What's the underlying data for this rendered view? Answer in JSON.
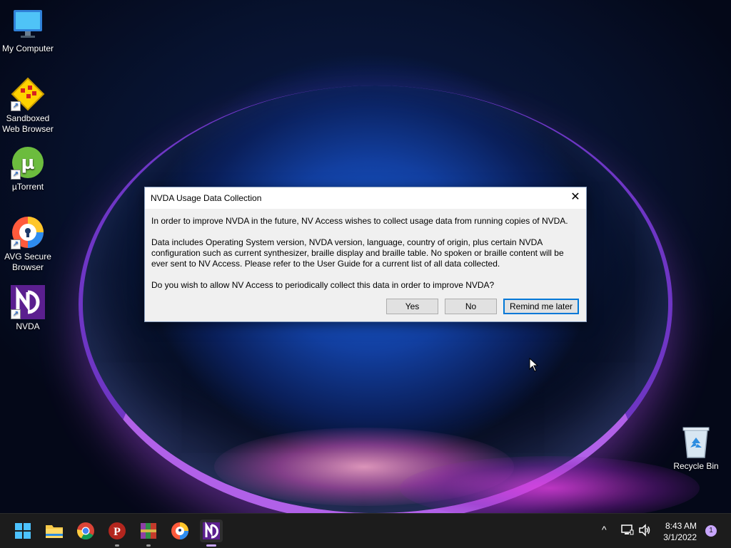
{
  "desktop": {
    "icons": [
      {
        "label": "My Computer",
        "icon": "monitor-icon"
      },
      {
        "label": "Sandboxed Web Browser",
        "icon": "sandbox-browser-icon"
      },
      {
        "label": "µTorrent",
        "icon": "utorrent-icon"
      },
      {
        "label": "AVG Secure Browser",
        "icon": "avg-browser-icon"
      },
      {
        "label": "NVDA",
        "icon": "nvda-icon"
      },
      {
        "label": "Recycle Bin",
        "icon": "recycle-bin-icon"
      }
    ]
  },
  "dialog": {
    "title": "NVDA  Usage Data Collection",
    "paragraph1": "In order to improve NVDA in the future, NV Access wishes to collect usage data from running copies of NVDA.",
    "paragraph2": "Data includes Operating System version, NVDA version, language, country of origin, plus certain NVDA configuration such as current synthesizer, braille display and braille table. No spoken or braille content will be ever sent to NV Access. Please refer to the User Guide for a current list of all data collected.",
    "paragraph3": "Do you wish to allow NV Access to periodically collect this data in order to improve NVDA?",
    "yes_label": "Yes",
    "no_label": "No",
    "later_label": "Remind me later",
    "close_glyph": "✕"
  },
  "taskbar": {
    "apps": [
      "start-icon",
      "file-explorer-icon",
      "chrome-icon",
      "pdf-app-icon",
      "winrar-icon",
      "avg-browser-icon",
      "nvda-icon"
    ],
    "clock_time": "8:43 AM",
    "clock_date": "3/1/2022",
    "notification_count": "1",
    "chevron_glyph": "^"
  },
  "colors": {
    "accent": "#0078d7",
    "nvda_purple": "#5b1f8f"
  }
}
